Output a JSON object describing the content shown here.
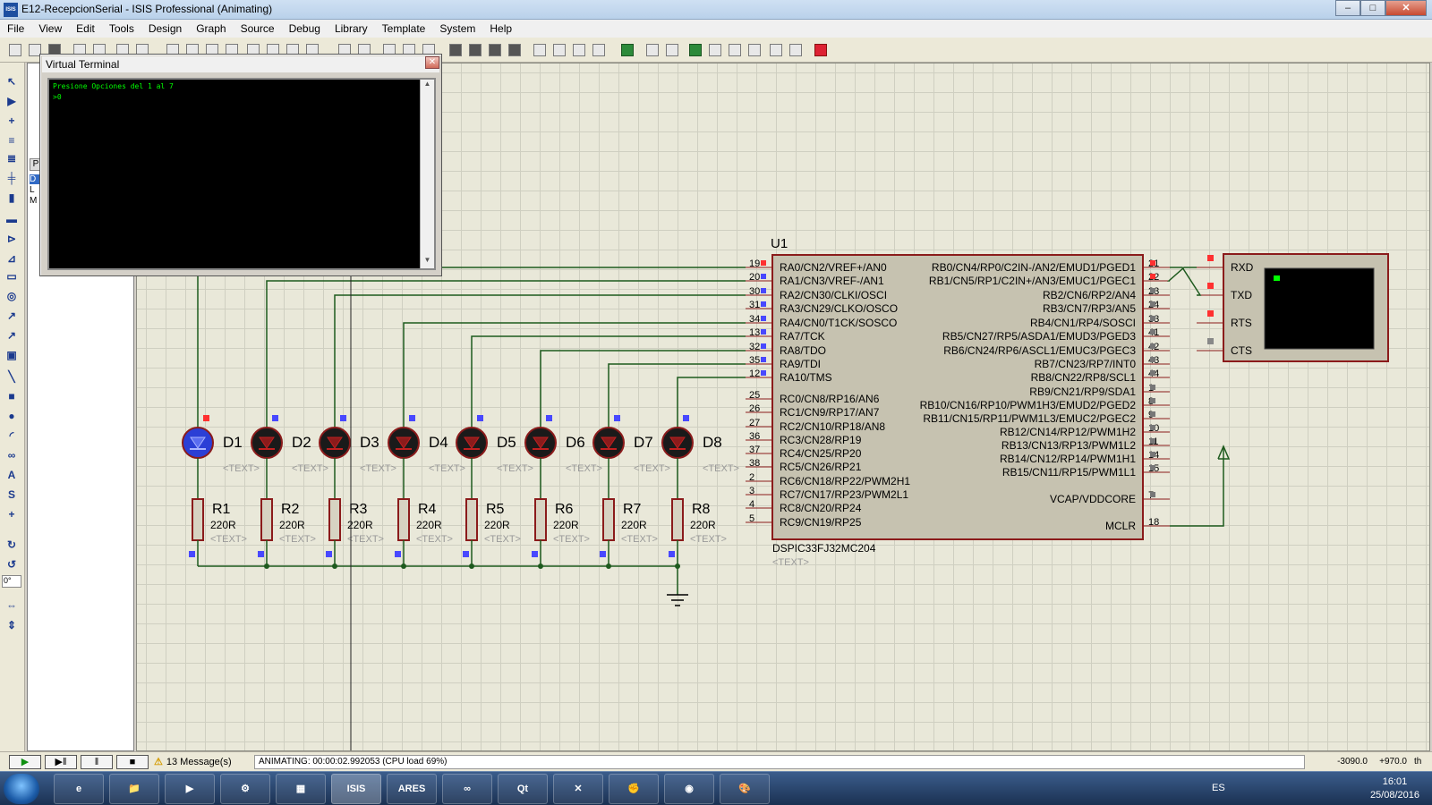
{
  "window": {
    "title": "E12-RecepcionSerial - ISIS Professional (Animating)",
    "minimize": "–",
    "maximize": "□",
    "close": "✕"
  },
  "menu": [
    "File",
    "View",
    "Edit",
    "Tools",
    "Design",
    "Graph",
    "Source",
    "Debug",
    "Library",
    "Template",
    "System",
    "Help"
  ],
  "object_panel": {
    "header": "P",
    "items": [
      "D",
      "L",
      "M"
    ]
  },
  "angle": "0°",
  "terminal": {
    "title": "Virtual Terminal",
    "close": "✕",
    "lines": [
      "Presione Opciones del 1 al 7",
      ">0"
    ],
    "scroll_up": "▲",
    "scroll_down": "▼"
  },
  "schematic": {
    "ic": {
      "ref": "U1",
      "part": "DSPIC33FJ32MC204",
      "text": "<TEXT>",
      "left_pins": [
        {
          "num": "19",
          "name": "RA0/CN2/VREF+/AN0"
        },
        {
          "num": "20",
          "name": "RA1/CN3/VREF-/AN1"
        },
        {
          "num": "30",
          "name": "RA2/CN30/CLKI/OSCI"
        },
        {
          "num": "31",
          "name": "RA3/CN29/CLKO/OSCO"
        },
        {
          "num": "34",
          "name": "RA4/CN0/T1CK/SOSCO"
        },
        {
          "num": "13",
          "name": "RA7/TCK"
        },
        {
          "num": "32",
          "name": "RA8/TDO"
        },
        {
          "num": "35",
          "name": "RA9/TDI"
        },
        {
          "num": "12",
          "name": "RA10/TMS"
        },
        {
          "num": "25",
          "name": "RC0/CN8/RP16/AN6"
        },
        {
          "num": "26",
          "name": "RC1/CN9/RP17/AN7"
        },
        {
          "num": "27",
          "name": "RC2/CN10/RP18/AN8"
        },
        {
          "num": "36",
          "name": "RC3/CN28/RP19"
        },
        {
          "num": "37",
          "name": "RC4/CN25/RP20"
        },
        {
          "num": "38",
          "name": "RC5/CN26/RP21"
        },
        {
          "num": "2",
          "name": "RC6/CN18/RP22/PWM2H1"
        },
        {
          "num": "3",
          "name": "RC7/CN17/RP23/PWM2L1"
        },
        {
          "num": "4",
          "name": "RC8/CN20/RP24"
        },
        {
          "num": "5",
          "name": "RC9/CN19/RP25"
        }
      ],
      "right_pins": [
        {
          "num": "21",
          "name": "RB0/CN4/RP0/C2IN-/AN2/EMUD1/PGED1"
        },
        {
          "num": "22",
          "name": "RB1/CN5/RP1/C2IN+/AN3/EMUC1/PGEC1"
        },
        {
          "num": "23",
          "name": "RB2/CN6/RP2/AN4"
        },
        {
          "num": "24",
          "name": "RB3/CN7/RP3/AN5"
        },
        {
          "num": "33",
          "name": "RB4/CN1/RP4/SOSCI"
        },
        {
          "num": "41",
          "name": "RB5/CN27/RP5/ASDA1/EMUD3/PGED3"
        },
        {
          "num": "42",
          "name": "RB6/CN24/RP6/ASCL1/EMUC3/PGEC3"
        },
        {
          "num": "43",
          "name": "RB7/CN23/RP7/INT0"
        },
        {
          "num": "44",
          "name": "RB8/CN22/RP8/SCL1"
        },
        {
          "num": "1",
          "name": "RB9/CN21/RP9/SDA1"
        },
        {
          "num": "8",
          "name": "RB10/CN16/RP10/PWM1H3/EMUD2/PGED2"
        },
        {
          "num": "9",
          "name": "RB11/CN15/RP11/PWM1L3/EMUC2/PGEC2"
        },
        {
          "num": "10",
          "name": "RB12/CN14/RP12/PWM1H2"
        },
        {
          "num": "11",
          "name": "RB13/CN13/RP13/PWM1L2"
        },
        {
          "num": "14",
          "name": "RB14/CN12/RP14/PWM1H1"
        },
        {
          "num": "15",
          "name": "RB15/CN11/RP15/PWM1L1"
        },
        {
          "num": "7",
          "name": "VCAP/VDDCORE"
        },
        {
          "num": "18",
          "name": "MCLR"
        }
      ]
    },
    "leds": [
      {
        "ref": "D1",
        "text": "<TEXT>",
        "on": true
      },
      {
        "ref": "D2",
        "text": "<TEXT>",
        "on": false
      },
      {
        "ref": "D3",
        "text": "<TEXT>",
        "on": false
      },
      {
        "ref": "D4",
        "text": "<TEXT>",
        "on": false
      },
      {
        "ref": "D5",
        "text": "<TEXT>",
        "on": false
      },
      {
        "ref": "D6",
        "text": "<TEXT>",
        "on": false
      },
      {
        "ref": "D7",
        "text": "<TEXT>",
        "on": false
      },
      {
        "ref": "D8",
        "text": "<TEXT>",
        "on": false
      }
    ],
    "resistors": [
      {
        "ref": "R1",
        "value": "220R",
        "text": "<TEXT>"
      },
      {
        "ref": "R2",
        "value": "220R",
        "text": "<TEXT>"
      },
      {
        "ref": "R3",
        "value": "220R",
        "text": "<TEXT>"
      },
      {
        "ref": "R4",
        "value": "220R",
        "text": "<TEXT>"
      },
      {
        "ref": "R5",
        "value": "220R",
        "text": "<TEXT>"
      },
      {
        "ref": "R6",
        "value": "220R",
        "text": "<TEXT>"
      },
      {
        "ref": "R7",
        "value": "220R",
        "text": "<TEXT>"
      },
      {
        "ref": "R8",
        "value": "220R",
        "text": "<TEXT>"
      }
    ],
    "terminal_device": {
      "pins": [
        "RXD",
        "TXD",
        "RTS",
        "CTS"
      ]
    },
    "colors": {
      "wire": "#1e5a1e",
      "component": "#8b1b1b",
      "ic_fill": "#c6c2b0",
      "led_off": "#1a1a1a",
      "led_on": "#2b3fd6",
      "pin_high": "#ff3030",
      "pin_low": "#4848ff"
    }
  },
  "status": {
    "messages": "13 Message(s)",
    "animation": "ANIMATING: 00:00:02.992053 (CPU load 69%)",
    "x": "-3090.0",
    "y": "+970.0",
    "unit": "th",
    "buttons": [
      "▶",
      "▶‖",
      "‖",
      "■"
    ]
  },
  "taskbar": {
    "apps": [
      "e",
      "📁",
      "▶",
      "⚙",
      "▦",
      "ISIS",
      "ARES",
      "∞",
      "Qt",
      "✕",
      "✊",
      "◉",
      "🎨"
    ],
    "language": "ES",
    "time": "16:01",
    "date": "25/08/2016"
  }
}
